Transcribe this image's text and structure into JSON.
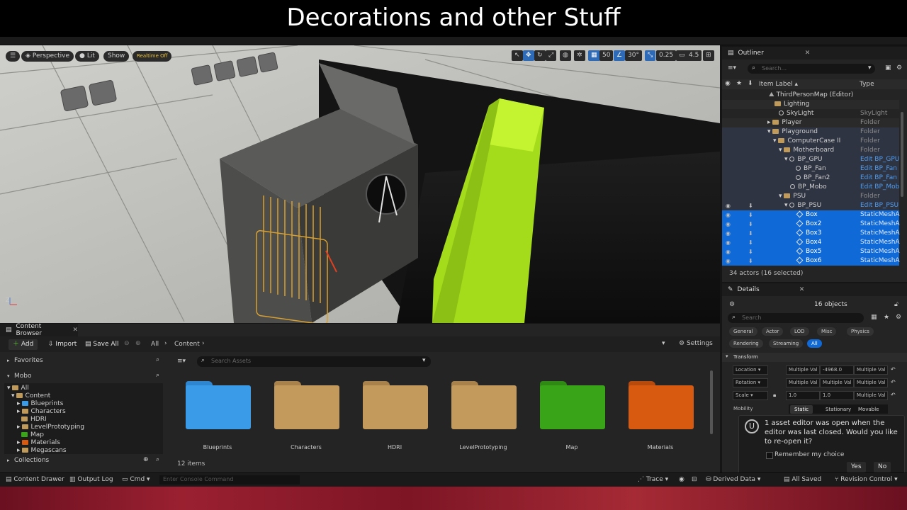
{
  "caption": "Decorations and other Stuff",
  "viewport": {
    "perspective": "Perspective",
    "lit": "Lit",
    "show": "Show",
    "realtime": "Realtime Off",
    "grid_snap": "50",
    "angle_snap": "30°",
    "scale_snap": "0.25",
    "camera_speed": "4.5"
  },
  "outliner": {
    "tab": "Outliner",
    "search_placeholder": "Search...",
    "col_label": "Item Label ▴",
    "col_type": "Type",
    "rows": [
      {
        "label": "ThirdPersonMap (Editor)",
        "type": ""
      },
      {
        "label": "Lighting",
        "type": ""
      },
      {
        "label": "SkyLight",
        "type": "SkyLight"
      },
      {
        "label": "Player",
        "type": "Folder"
      },
      {
        "label": "Playground",
        "type": "Folder"
      },
      {
        "label": "ComputerCase II",
        "type": "Folder"
      },
      {
        "label": "Motherboard",
        "type": "Folder"
      },
      {
        "label": "BP_GPU",
        "type": "Edit BP_GPU"
      },
      {
        "label": "BP_Fan",
        "type": "Edit BP_Fan"
      },
      {
        "label": "BP_Fan2",
        "type": "Edit BP_Fan"
      },
      {
        "label": "BP_Mobo",
        "type": "Edit BP_Mob"
      },
      {
        "label": "PSU",
        "type": "Folder"
      },
      {
        "label": "BP_PSU",
        "type": "Edit BP_PSU"
      },
      {
        "label": "Box",
        "type": "StaticMeshA"
      },
      {
        "label": "Box2",
        "type": "StaticMeshA"
      },
      {
        "label": "Box3",
        "type": "StaticMeshA"
      },
      {
        "label": "Box4",
        "type": "StaticMeshA"
      },
      {
        "label": "Box5",
        "type": "StaticMeshA"
      },
      {
        "label": "Box6",
        "type": "StaticMeshA"
      }
    ],
    "footer": "34 actors (16 selected)"
  },
  "details": {
    "tab": "Details",
    "objects": "16 objects",
    "search_placeholder": "Search",
    "filters": [
      "General",
      "Actor",
      "LOD",
      "Misc",
      "Physics",
      "Rendering",
      "Streaming",
      "All"
    ],
    "section": "Transform",
    "location_label": "Location",
    "rotation_label": "Rotation",
    "scale_label": "Scale",
    "mobility_label": "Mobility",
    "multiple": "Multiple Val",
    "location_y": "-4968.0",
    "scale_x": "1.0",
    "scale_y": "1.0",
    "mobility": [
      "Static",
      "Stationary",
      "Movable"
    ]
  },
  "toast": {
    "message": "1 asset editor was open when the editor was last closed. Would you like to re-open it?",
    "remember": "Remember my choice",
    "yes": "Yes",
    "no": "No"
  },
  "content_browser": {
    "tab": "Content Browser",
    "add": "Add",
    "import": "Import",
    "save_all": "Save All",
    "path_all": "All",
    "path_content": "Content",
    "settings": "Settings",
    "favorites": "Favorites",
    "project": "Mobo",
    "tree": [
      "All",
      "Content",
      "Blueprints",
      "Characters",
      "HDRI",
      "LevelPrototyping",
      "Map",
      "Materials",
      "Megascans"
    ],
    "collections": "Collections",
    "search_placeholder": "Search Assets",
    "assets": [
      "Blueprints",
      "Characters",
      "HDRI",
      "LevelPrototyping",
      "Map",
      "Materials"
    ],
    "item_count": "12 items"
  },
  "statusbar": {
    "content_drawer": "Content Drawer",
    "output_log": "Output Log",
    "cmd": "Cmd",
    "console_placeholder": "Enter Console Command",
    "trace": "Trace",
    "derived_data": "Derived Data",
    "all_saved": "All Saved",
    "revision_control": "Revision Control"
  },
  "colors": {
    "accent_blue": "#0f6ad8",
    "lime": "#b8f020",
    "folder_blue": "#3a9be8",
    "folder_tan": "#c49a5c",
    "folder_green": "#3aa418",
    "folder_orange": "#d85a10"
  }
}
